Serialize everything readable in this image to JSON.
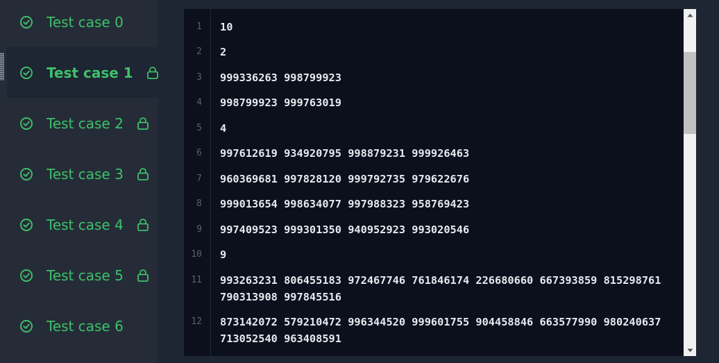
{
  "test_cases": [
    {
      "label": "Test case 0",
      "locked": false,
      "active": false
    },
    {
      "label": "Test case 1",
      "locked": true,
      "active": true
    },
    {
      "label": "Test case 2",
      "locked": true,
      "active": false
    },
    {
      "label": "Test case 3",
      "locked": true,
      "active": false
    },
    {
      "label": "Test case 4",
      "locked": true,
      "active": false
    },
    {
      "label": "Test case 5",
      "locked": true,
      "active": false
    },
    {
      "label": "Test case 6",
      "locked": false,
      "active": false
    }
  ],
  "editor": {
    "lines": [
      {
        "num": "1",
        "text": "10"
      },
      {
        "num": "2",
        "text": "2"
      },
      {
        "num": "3",
        "text": "999336263 998799923"
      },
      {
        "num": "4",
        "text": "998799923 999763019"
      },
      {
        "num": "5",
        "text": "4"
      },
      {
        "num": "6",
        "text": "997612619 934920795 998879231 999926463"
      },
      {
        "num": "7",
        "text": "960369681 997828120 999792735 979622676"
      },
      {
        "num": "8",
        "text": "999013654 998634077 997988323 958769423"
      },
      {
        "num": "9",
        "text": "997409523 999301350 940952923 993020546"
      },
      {
        "num": "10",
        "text": "9"
      },
      {
        "num": "11",
        "text": "993263231 806455183 972467746 761846174 226680660 667393859 815298761 790313908 997845516"
      },
      {
        "num": "12",
        "text": "873142072 579210472 996344520 999601755 904458846 663577990 980240637 713052540 963408591"
      }
    ]
  },
  "colors": {
    "accent": "#3ec06a",
    "sidebar_bg": "#252c38",
    "editor_bg": "#0b101c"
  },
  "icons": {
    "status": "check-circle-icon",
    "lock": "lock-icon"
  }
}
